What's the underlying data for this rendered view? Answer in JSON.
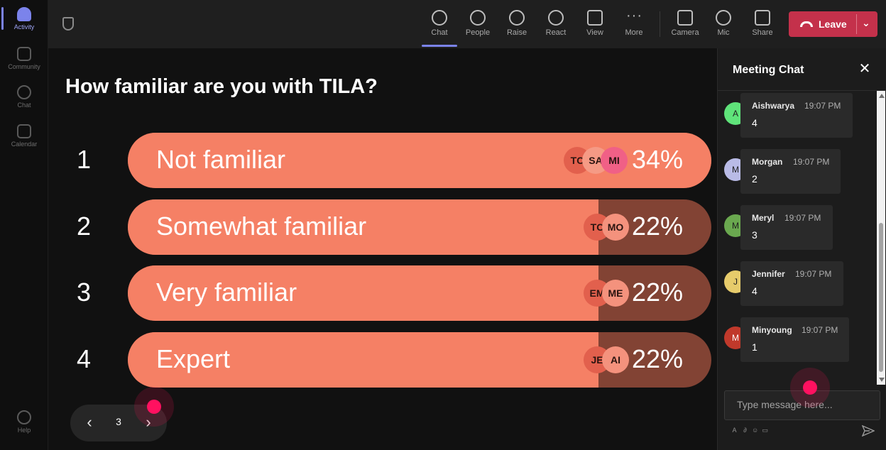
{
  "rail": {
    "items": [
      {
        "label": "Activity"
      },
      {
        "label": "Community"
      },
      {
        "label": "Chat"
      },
      {
        "label": "Calendar"
      }
    ],
    "help_label": "Help"
  },
  "toolbar": {
    "buttons": [
      {
        "label": "Chat"
      },
      {
        "label": "People"
      },
      {
        "label": "Raise"
      },
      {
        "label": "React"
      },
      {
        "label": "View"
      },
      {
        "label": "More"
      },
      {
        "label": "Camera"
      },
      {
        "label": "Mic"
      },
      {
        "label": "Share"
      }
    ],
    "leave_label": "Leave"
  },
  "poll": {
    "question": "How familiar are you with TILA?",
    "options": [
      {
        "number": "1",
        "label": "Not familiar",
        "percent_text": "34%",
        "fill_percent": 100,
        "voters": [
          "TC",
          "SA",
          "MI"
        ]
      },
      {
        "number": "2",
        "label": "Somewhat familiar",
        "percent_text": "22%",
        "fill_percent": 80.7,
        "voters": [
          "TC",
          "MO"
        ]
      },
      {
        "number": "3",
        "label": "Very familiar",
        "percent_text": "22%",
        "fill_percent": 80.7,
        "voters": [
          "EM",
          "ME"
        ]
      },
      {
        "number": "4",
        "label": "Expert",
        "percent_text": "22%",
        "fill_percent": 80.7,
        "voters": [
          "JE",
          "AI"
        ]
      }
    ],
    "pager": {
      "page": "3"
    }
  },
  "chat": {
    "title": "Meeting Chat",
    "messages": [
      {
        "initial": "A",
        "name": "Aishwarya",
        "time": "19:07 PM",
        "text": "4",
        "avatar_color": "#5fe37a"
      },
      {
        "initial": "M",
        "name": "Morgan",
        "time": "19:07 PM",
        "text": "2",
        "avatar_color": "#b9bbe6"
      },
      {
        "initial": "M",
        "name": "Meryl",
        "time": "19:07 PM",
        "text": "3",
        "avatar_color": "#6aa84f"
      },
      {
        "initial": "J",
        "name": "Jennifer",
        "time": "19:07 PM",
        "text": "4",
        "avatar_color": "#e6cb6b"
      },
      {
        "initial": "M",
        "name": "Minyoung",
        "time": "19:07 PM",
        "text": "1",
        "avatar_color": "#c0392b"
      }
    ],
    "placeholder": "Type message here..."
  },
  "colors": {
    "bar_fill": "#f58065",
    "bar_track": "#824334",
    "accent": "#7b83eb",
    "leave": "#c4314b",
    "click_marker": "#ff1160"
  }
}
